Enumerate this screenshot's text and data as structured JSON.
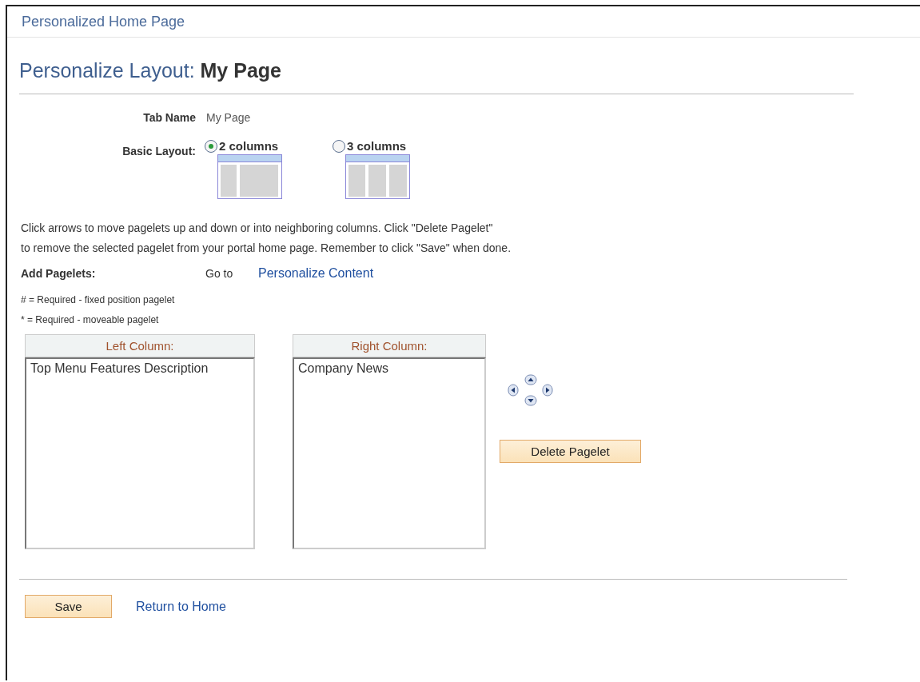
{
  "header": {
    "title": "Personalized Home Page"
  },
  "page_title": {
    "prefix": "Personalize Layout:",
    "name": "My Page"
  },
  "tab_name": {
    "label": "Tab Name",
    "value": "My Page"
  },
  "basic_layout": {
    "label": "Basic Layout:",
    "options": [
      {
        "label": "2 columns",
        "selected": true,
        "kind": "two"
      },
      {
        "label": "3 columns",
        "selected": false,
        "kind": "three"
      }
    ]
  },
  "instructions": [
    "Click arrows to move pagelets up and down or into neighboring columns. Click \"Delete Pagelet\"",
    "to remove the selected pagelet from your portal home page. Remember to click \"Save\" when done."
  ],
  "add_pagelets": {
    "label": "Add Pagelets:",
    "prefix": "Go to",
    "link": "Personalize Content"
  },
  "legend": [
    "# = Required - fixed position pagelet",
    "* = Required - moveable pagelet"
  ],
  "columns": [
    {
      "title": "Left Column:",
      "items": [
        "Top Menu Features Description"
      ]
    },
    {
      "title": "Right Column:",
      "items": [
        "Company News"
      ]
    }
  ],
  "delete_button": "Delete Pagelet",
  "save_button": "Save",
  "return_link": "Return to Home"
}
